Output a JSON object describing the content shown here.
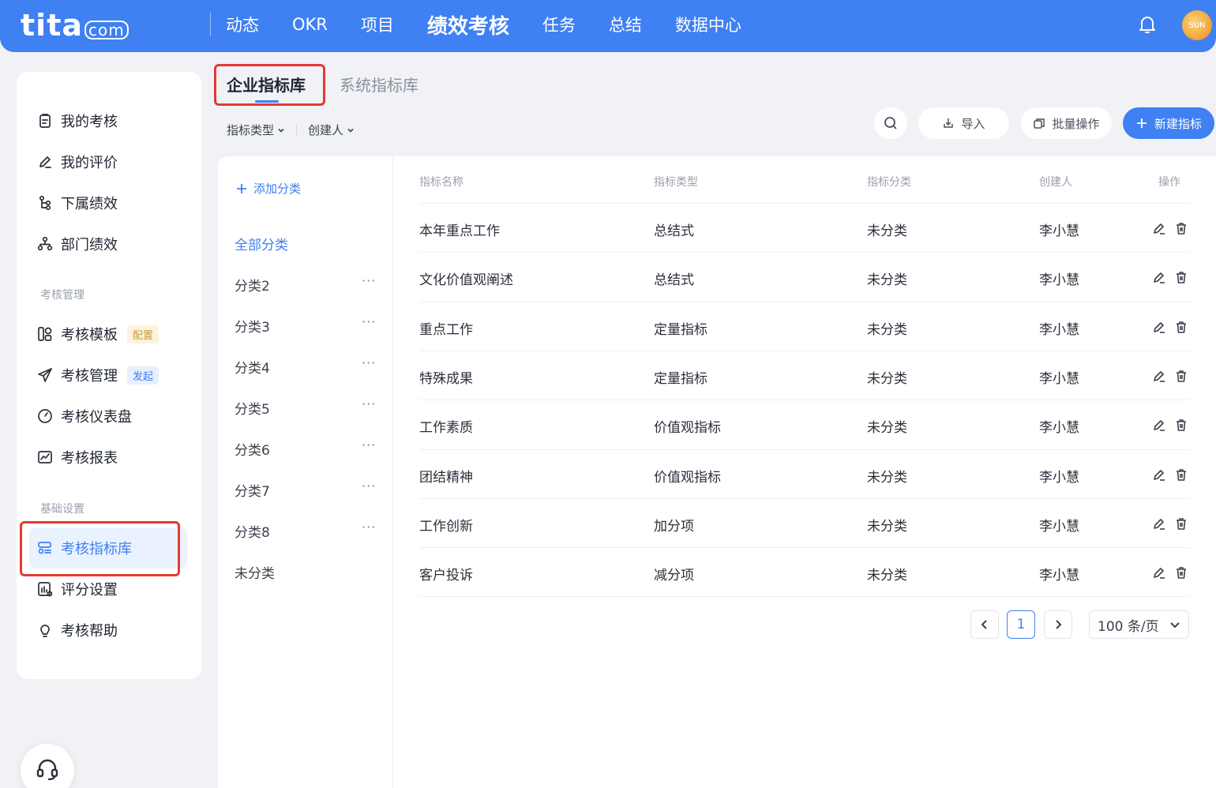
{
  "app": {
    "logo_text": "tita",
    "logo_suffix": "com",
    "avatar_text": "SUN",
    "nav": [
      "动态",
      "OKR",
      "项目",
      "绩效考核",
      "任务",
      "总结",
      "数据中心"
    ],
    "nav_active_index": 3
  },
  "sidebar": {
    "items_top": [
      {
        "label": "我的考核",
        "icon": "clipboard-icon"
      },
      {
        "label": "我的评价",
        "icon": "pen-icon"
      },
      {
        "label": "下属绩效",
        "icon": "org-tree-icon"
      },
      {
        "label": "部门绩效",
        "icon": "department-icon"
      }
    ],
    "section_manage": "考核管理",
    "items_manage": [
      {
        "label": "考核模板",
        "icon": "template-icon",
        "badge": "配置"
      },
      {
        "label": "考核管理",
        "icon": "send-icon",
        "badge": "发起"
      },
      {
        "label": "考核仪表盘",
        "icon": "gauge-icon"
      },
      {
        "label": "考核报表",
        "icon": "report-icon"
      }
    ],
    "section_base": "基础设置",
    "items_base": [
      {
        "label": "考核指标库",
        "icon": "indicator-library-icon",
        "active": true
      },
      {
        "label": "评分设置",
        "icon": "score-settings-icon"
      },
      {
        "label": "考核帮助",
        "icon": "bulb-icon"
      }
    ]
  },
  "tabs": {
    "active": "企业指标库",
    "inactive": "系统指标库"
  },
  "filters": {
    "type": "指标类型",
    "creator": "创建人"
  },
  "toolbar": {
    "import": "导入",
    "batch": "批量操作",
    "create": "新建指标"
  },
  "categories": {
    "add": "添加分类",
    "all": "全部分类",
    "items": [
      "分类2",
      "分类3",
      "分类4",
      "分类5",
      "分类6",
      "分类7",
      "分类8"
    ],
    "uncategorized": "未分类",
    "more": "···"
  },
  "table": {
    "headers": [
      "指标名称",
      "指标类型",
      "指标分类",
      "创建人",
      "操作"
    ],
    "rows": [
      [
        "本年重点工作",
        "总结式",
        "未分类",
        "李小慧"
      ],
      [
        "文化价值观阐述",
        "总结式",
        "未分类",
        "李小慧"
      ],
      [
        "重点工作",
        "定量指标",
        "未分类",
        "李小慧"
      ],
      [
        "特殊成果",
        "定量指标",
        "未分类",
        "李小慧"
      ],
      [
        "工作素质",
        "价值观指标",
        "未分类",
        "李小慧"
      ],
      [
        "团结精神",
        "价值观指标",
        "未分类",
        "李小慧"
      ],
      [
        "工作创新",
        "加分项",
        "未分类",
        "李小慧"
      ],
      [
        "客户投诉",
        "减分项",
        "未分类",
        "李小慧"
      ]
    ]
  },
  "pagination": {
    "current": "1",
    "page_size": "100 条/页"
  },
  "colors": {
    "brand": "#3f80f2",
    "highlight_box": "#e53935"
  }
}
